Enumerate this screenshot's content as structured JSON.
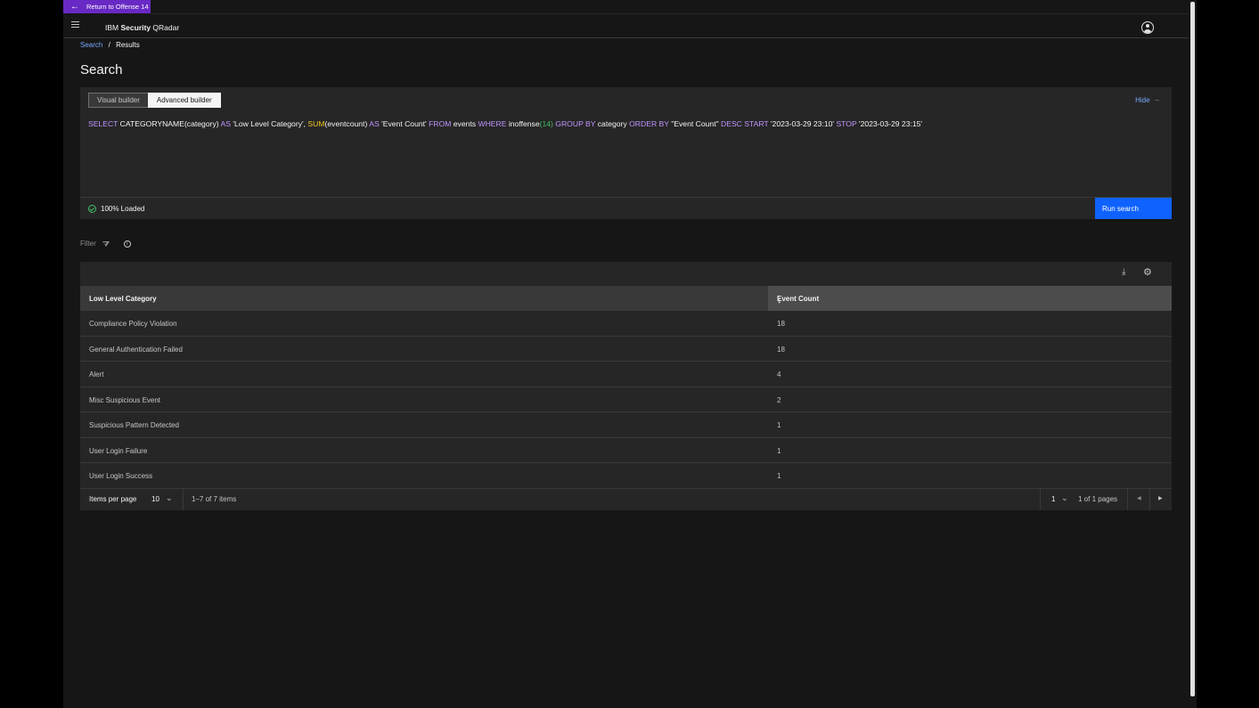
{
  "return_bar": {
    "label": "Return to Offense 14"
  },
  "header": {
    "brand_prefix": "IBM",
    "brand_bold": "Security",
    "brand_product": "QRadar"
  },
  "breadcrumb": {
    "link": "Search",
    "separator": "/",
    "current": "Results"
  },
  "page_title": "Search",
  "builder": {
    "tabs": [
      "Visual builder",
      "Advanced builder"
    ],
    "active_tab": "Advanced builder",
    "hide_label": "Hide",
    "query_tokens": [
      {
        "t": "SELECT",
        "c": "kw"
      },
      {
        "t": " CATEGORYNAME",
        "c": ""
      },
      {
        "t": "(category)",
        "c": ""
      },
      {
        "t": " AS",
        "c": "kw"
      },
      {
        "t": " 'Low Level Category', ",
        "c": ""
      },
      {
        "t": "SUM",
        "c": "fn"
      },
      {
        "t": "(eventcount)",
        "c": ""
      },
      {
        "t": " AS",
        "c": "kw"
      },
      {
        "t": " 'Event Count' ",
        "c": ""
      },
      {
        "t": "FROM",
        "c": "kw"
      },
      {
        "t": " events ",
        "c": ""
      },
      {
        "t": "WHERE",
        "c": "kw"
      },
      {
        "t": " inoffense",
        "c": ""
      },
      {
        "t": "(14)",
        "c": "num"
      },
      {
        "t": " GROUP BY",
        "c": "kw"
      },
      {
        "t": " category ",
        "c": ""
      },
      {
        "t": "ORDER BY",
        "c": "kw"
      },
      {
        "t": " \"Event Count\" ",
        "c": ""
      },
      {
        "t": "DESC",
        "c": "kw"
      },
      {
        "t": "  ",
        "c": ""
      },
      {
        "t": "START",
        "c": "kw"
      },
      {
        "t": " '2023-03-29 23:10' ",
        "c": ""
      },
      {
        "t": "STOP",
        "c": "kw"
      },
      {
        "t": " '2023-03-29 23:15'",
        "c": ""
      }
    ],
    "status": "100% Loaded",
    "run_button": "Run search"
  },
  "filter": {
    "label": "Filter"
  },
  "table": {
    "columns": [
      "Low Level Category",
      "Event Count"
    ],
    "sort_column": "Event Count",
    "sort_direction": "descending",
    "rows": [
      {
        "category": "Compliance Policy Violation",
        "count": "18"
      },
      {
        "category": "General Authentication Failed",
        "count": "18"
      },
      {
        "category": "Alert",
        "count": "4"
      },
      {
        "category": "Misc Suspicious Event",
        "count": "2"
      },
      {
        "category": "Suspicious Pattern Detected",
        "count": "1"
      },
      {
        "category": "User Login Failure",
        "count": "1"
      },
      {
        "category": "User Login Success",
        "count": "1"
      }
    ]
  },
  "pager": {
    "items_per_page_label": "Items per page",
    "items_per_page": "10",
    "range": "1–7 of 7 items",
    "page": "1",
    "page_of": "1 of 1 pages"
  },
  "colors": {
    "accent_purple": "#6929c4",
    "primary_blue": "#0f62fe",
    "link_blue": "#78a9ff",
    "success_green": "#42be65"
  },
  "icons": [
    "arrow-left-icon",
    "menu-icon",
    "user-avatar-icon",
    "check-circle-icon",
    "filter-icon",
    "info-icon",
    "download-icon",
    "settings-icon",
    "sort-arrow-down-icon",
    "chevron-down-icon",
    "caret-left-icon",
    "caret-right-icon"
  ]
}
